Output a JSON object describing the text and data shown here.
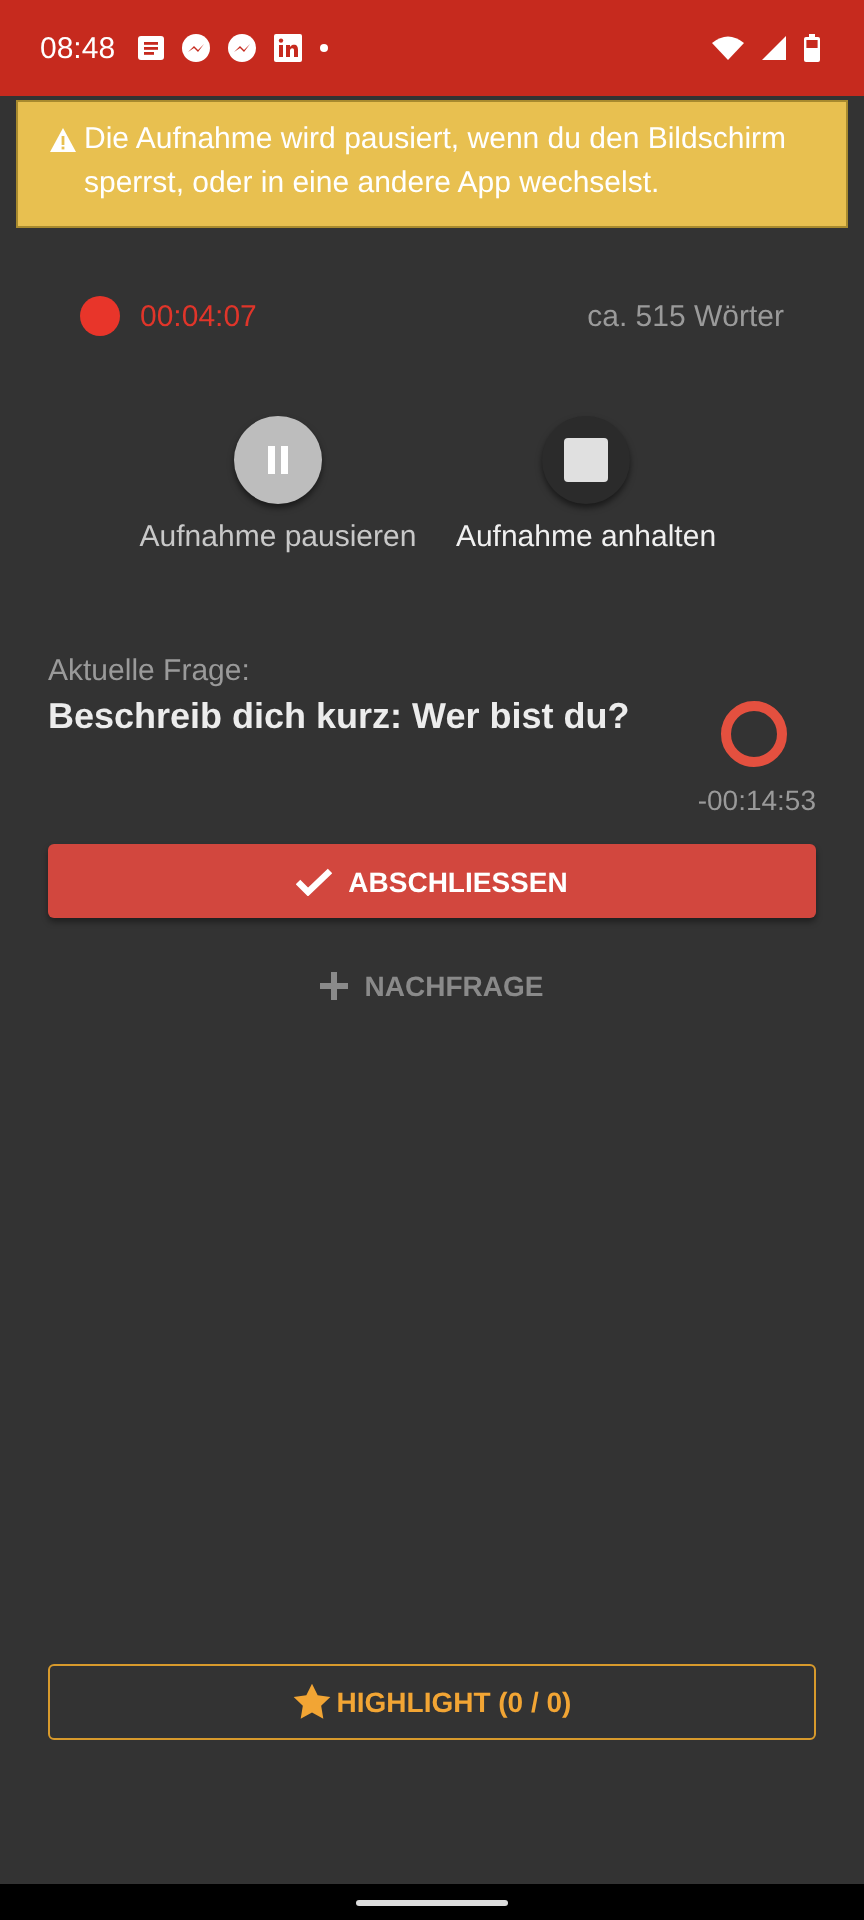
{
  "status_bar": {
    "time": "08:48"
  },
  "warning": {
    "text": "Die Aufnahme wird pausiert, wenn du den Bildschirm sperrst, oder in eine andere App wechselst."
  },
  "recording": {
    "elapsed": "00:04:07",
    "word_count": "ca. 515 Wörter"
  },
  "controls": [
    {
      "kind": "pause",
      "label": "Aufnahme pausieren",
      "selected": true
    },
    {
      "kind": "stop",
      "label": "Aufnahme anhalten",
      "selected": false
    }
  ],
  "question": {
    "label": "Aktuelle Frage:",
    "text": "Beschreib dich kurz: Wer bist du?",
    "remaining": "-00:14:53"
  },
  "finish_button": "ABSCHLIESSEN",
  "followup_button": "NACHFRAGE",
  "highlight_button": "HIGHLIGHT (0 / 0)"
}
